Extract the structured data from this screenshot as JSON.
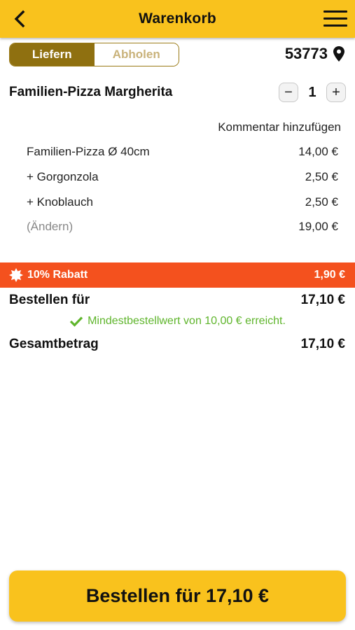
{
  "header": {
    "title": "Warenkorb",
    "back_icon": "chevron-left-icon",
    "menu_icon": "hamburger-menu-icon"
  },
  "delivery": {
    "options": [
      "Liefern",
      "Abholen"
    ],
    "selected": "Liefern",
    "zip": "53773",
    "location_icon": "map-pin-icon"
  },
  "item": {
    "name": "Familien-Pizza Margherita",
    "quantity": "1",
    "minus_label": "−",
    "plus_label": "+",
    "comment_link": "Kommentar hinzufügen",
    "lines": [
      {
        "label": "Familien-Pizza Ø 40cm",
        "price": "14,00 €"
      },
      {
        "label": "+ Gorgonzola",
        "price": "2,50 €"
      },
      {
        "label": "+ Knoblauch",
        "price": "2,50 €"
      }
    ],
    "change_label": "(Ändern)",
    "subtotal": "19,00 €"
  },
  "discount": {
    "label": "10% Rabatt",
    "amount": "1,90 €",
    "icon": "badge-star-icon"
  },
  "summary": {
    "order_for_label": "Bestellen für",
    "order_for_amount": "17,10 €",
    "minimum_text": "Mindestbestellwert von 10,00 € erreicht.",
    "total_label": "Gesamtbetrag",
    "total_amount": "17,10 €"
  },
  "checkout_button": "Bestellen für 17,10 €",
  "colors": {
    "brand_yellow": "#f9c21d",
    "toggle_active": "#8f7010",
    "discount_orange": "#f4511e",
    "success_green": "#5fb52c"
  }
}
